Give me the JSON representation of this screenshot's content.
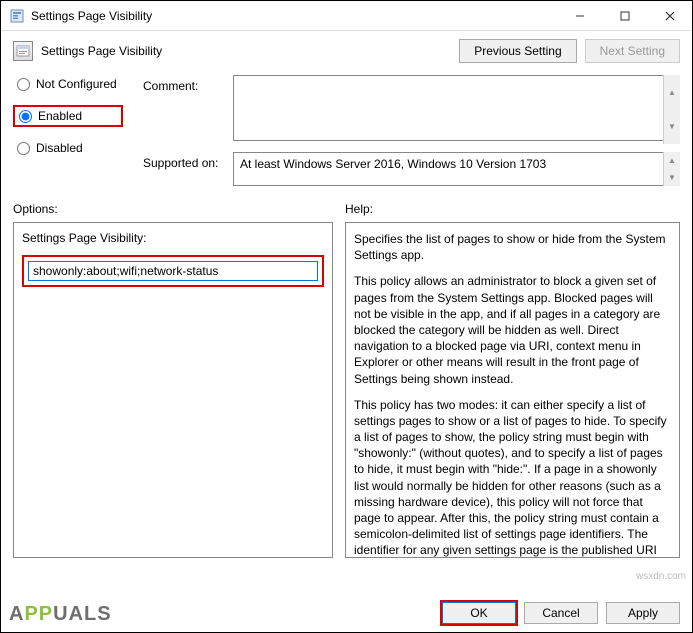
{
  "window": {
    "title": "Settings Page Visibility"
  },
  "header": {
    "title": "Settings Page Visibility"
  },
  "nav": {
    "previous": "Previous Setting",
    "next": "Next Setting"
  },
  "state": {
    "not_configured": "Not Configured",
    "enabled": "Enabled",
    "disabled": "Disabled",
    "selected": "enabled"
  },
  "comment": {
    "label": "Comment:",
    "value": ""
  },
  "supported": {
    "label": "Supported on:",
    "value": "At least Windows Server 2016, Windows 10 Version 1703"
  },
  "options": {
    "section_label": "Options:",
    "field_label": "Settings Page Visibility:",
    "value": "showonly:about;wifi;network-status"
  },
  "help": {
    "section_label": "Help:",
    "p1": "Specifies the list of pages to show or hide from the System Settings app.",
    "p2": "This policy allows an administrator to block a given set of pages from the System Settings app. Blocked pages will not be visible in the app, and if all pages in a category are blocked the category will be hidden as well. Direct navigation to a blocked page via URI, context menu in Explorer or other means will result in the front page of Settings being shown instead.",
    "p3": "This policy has two modes: it can either specify a list of settings pages to show or a list of pages to hide. To specify a list of pages to show, the policy string must begin with \"showonly:\" (without quotes), and to specify a list of pages to hide, it must begin with \"hide:\". If a page in a showonly list would normally be hidden for other reasons (such as a missing hardware device), this policy will not force that page to appear. After this, the policy string must contain a semicolon-delimited list of settings page identifiers. The identifier for any given settings page is the published URI for that page, minus the \"ms-settings:\" protocol part."
  },
  "buttons": {
    "ok": "OK",
    "cancel": "Cancel",
    "apply": "Apply"
  },
  "watermark": {
    "text_a": "A",
    "text_pp": "PP",
    "text_uals": "UALS"
  },
  "attribution": "wsxdn.com"
}
